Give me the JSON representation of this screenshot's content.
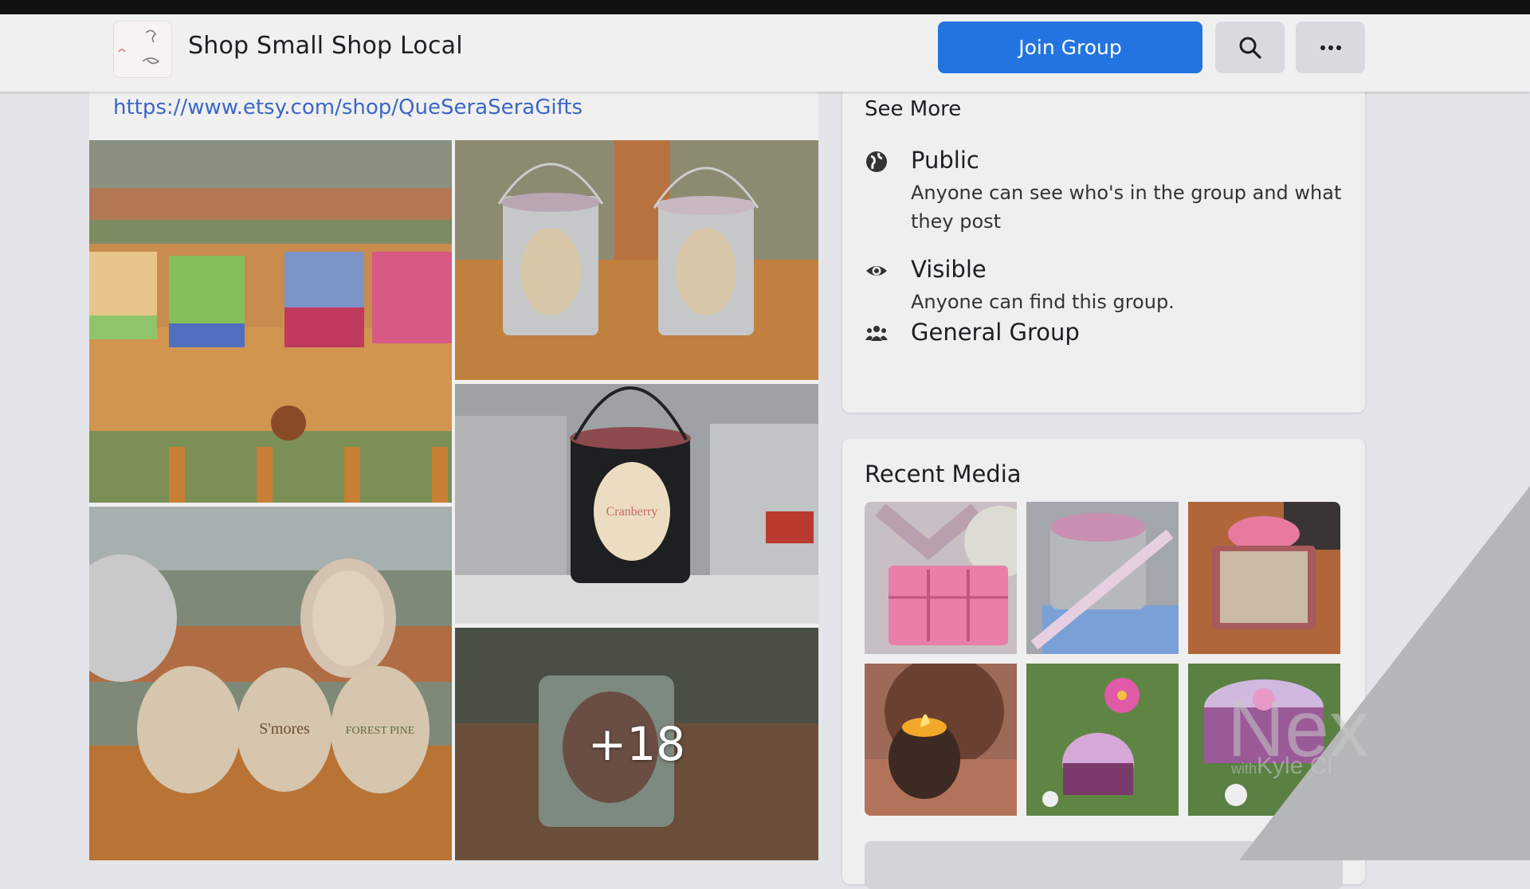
{
  "header": {
    "group_name": "Shop Small Shop Local",
    "join_button": "Join Group",
    "search_icon": "search-icon",
    "more_icon": "more-options-icon",
    "more_label": "···"
  },
  "post": {
    "link": "https://www.etsy.com/shop/QueSeraSeraGifts",
    "photos": [
      {
        "subject": "stacks of colorful wax melts on wooden railing"
      },
      {
        "subject": "two tin bucket candles"
      },
      {
        "subject": "Cranberry candle in black bucket"
      },
      {
        "subject": "tin candles including S'mores and Forest Pine"
      },
      {
        "subject": "square glass candle"
      }
    ],
    "more_count": "+18"
  },
  "about": {
    "see_more": "See More",
    "items": [
      {
        "icon": "globe-icon",
        "title": "Public",
        "desc": "Anyone can see who's in the group and what they post"
      },
      {
        "icon": "eye-icon",
        "title": "Visible",
        "desc": "Anyone can find this group."
      },
      {
        "icon": "group-icon",
        "title": "General Group",
        "desc": ""
      }
    ]
  },
  "recent_media": {
    "title": "Recent Media",
    "thumbs": [
      {
        "subject": "pink wax melt with ribbon"
      },
      {
        "subject": "pink tin candle with ribbon"
      },
      {
        "subject": "pink candle and wax melt package"
      },
      {
        "subject": "lit candle in brown holder"
      },
      {
        "subject": "purple candle with pink flower in grass"
      },
      {
        "subject": "purple jar candle in grass"
      }
    ]
  },
  "watermark": {
    "big": "Nex",
    "with": "with",
    "name": "Kyle Cl"
  },
  "colors": {
    "accent": "#2374e1",
    "link": "#3b67c6"
  }
}
